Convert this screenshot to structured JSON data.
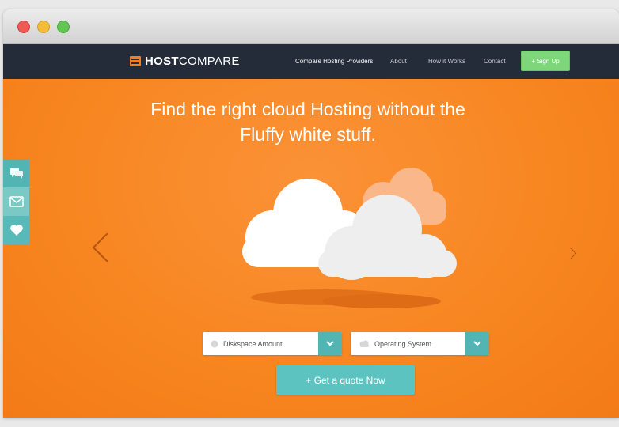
{
  "colors": {
    "hero_orange": "#f7851f",
    "navbar_dark": "#242c3a",
    "teal": "#52b5b4",
    "signup_green": "#7ed67a"
  },
  "window": {
    "traffic_lights": [
      "close",
      "minimize",
      "zoom"
    ]
  },
  "nav": {
    "logo_bold": "HOST",
    "logo_light": "COMPARE",
    "links": [
      {
        "label": "Compare Hosting Providers"
      },
      {
        "label": "About"
      },
      {
        "label": "How it Works"
      },
      {
        "label": "Contact"
      }
    ],
    "signup_label": "+ Sign Up"
  },
  "hero": {
    "headline_line1": "Find the right cloud Hosting without the",
    "headline_line2": "Fluffy white stuff."
  },
  "share": {
    "icons": [
      "chat-icon",
      "mail-icon",
      "heart-icon"
    ]
  },
  "form": {
    "diskspace_label": "Diskspace Amount",
    "os_label": "Operating System",
    "quote_label": "+ Get a quote Now"
  }
}
